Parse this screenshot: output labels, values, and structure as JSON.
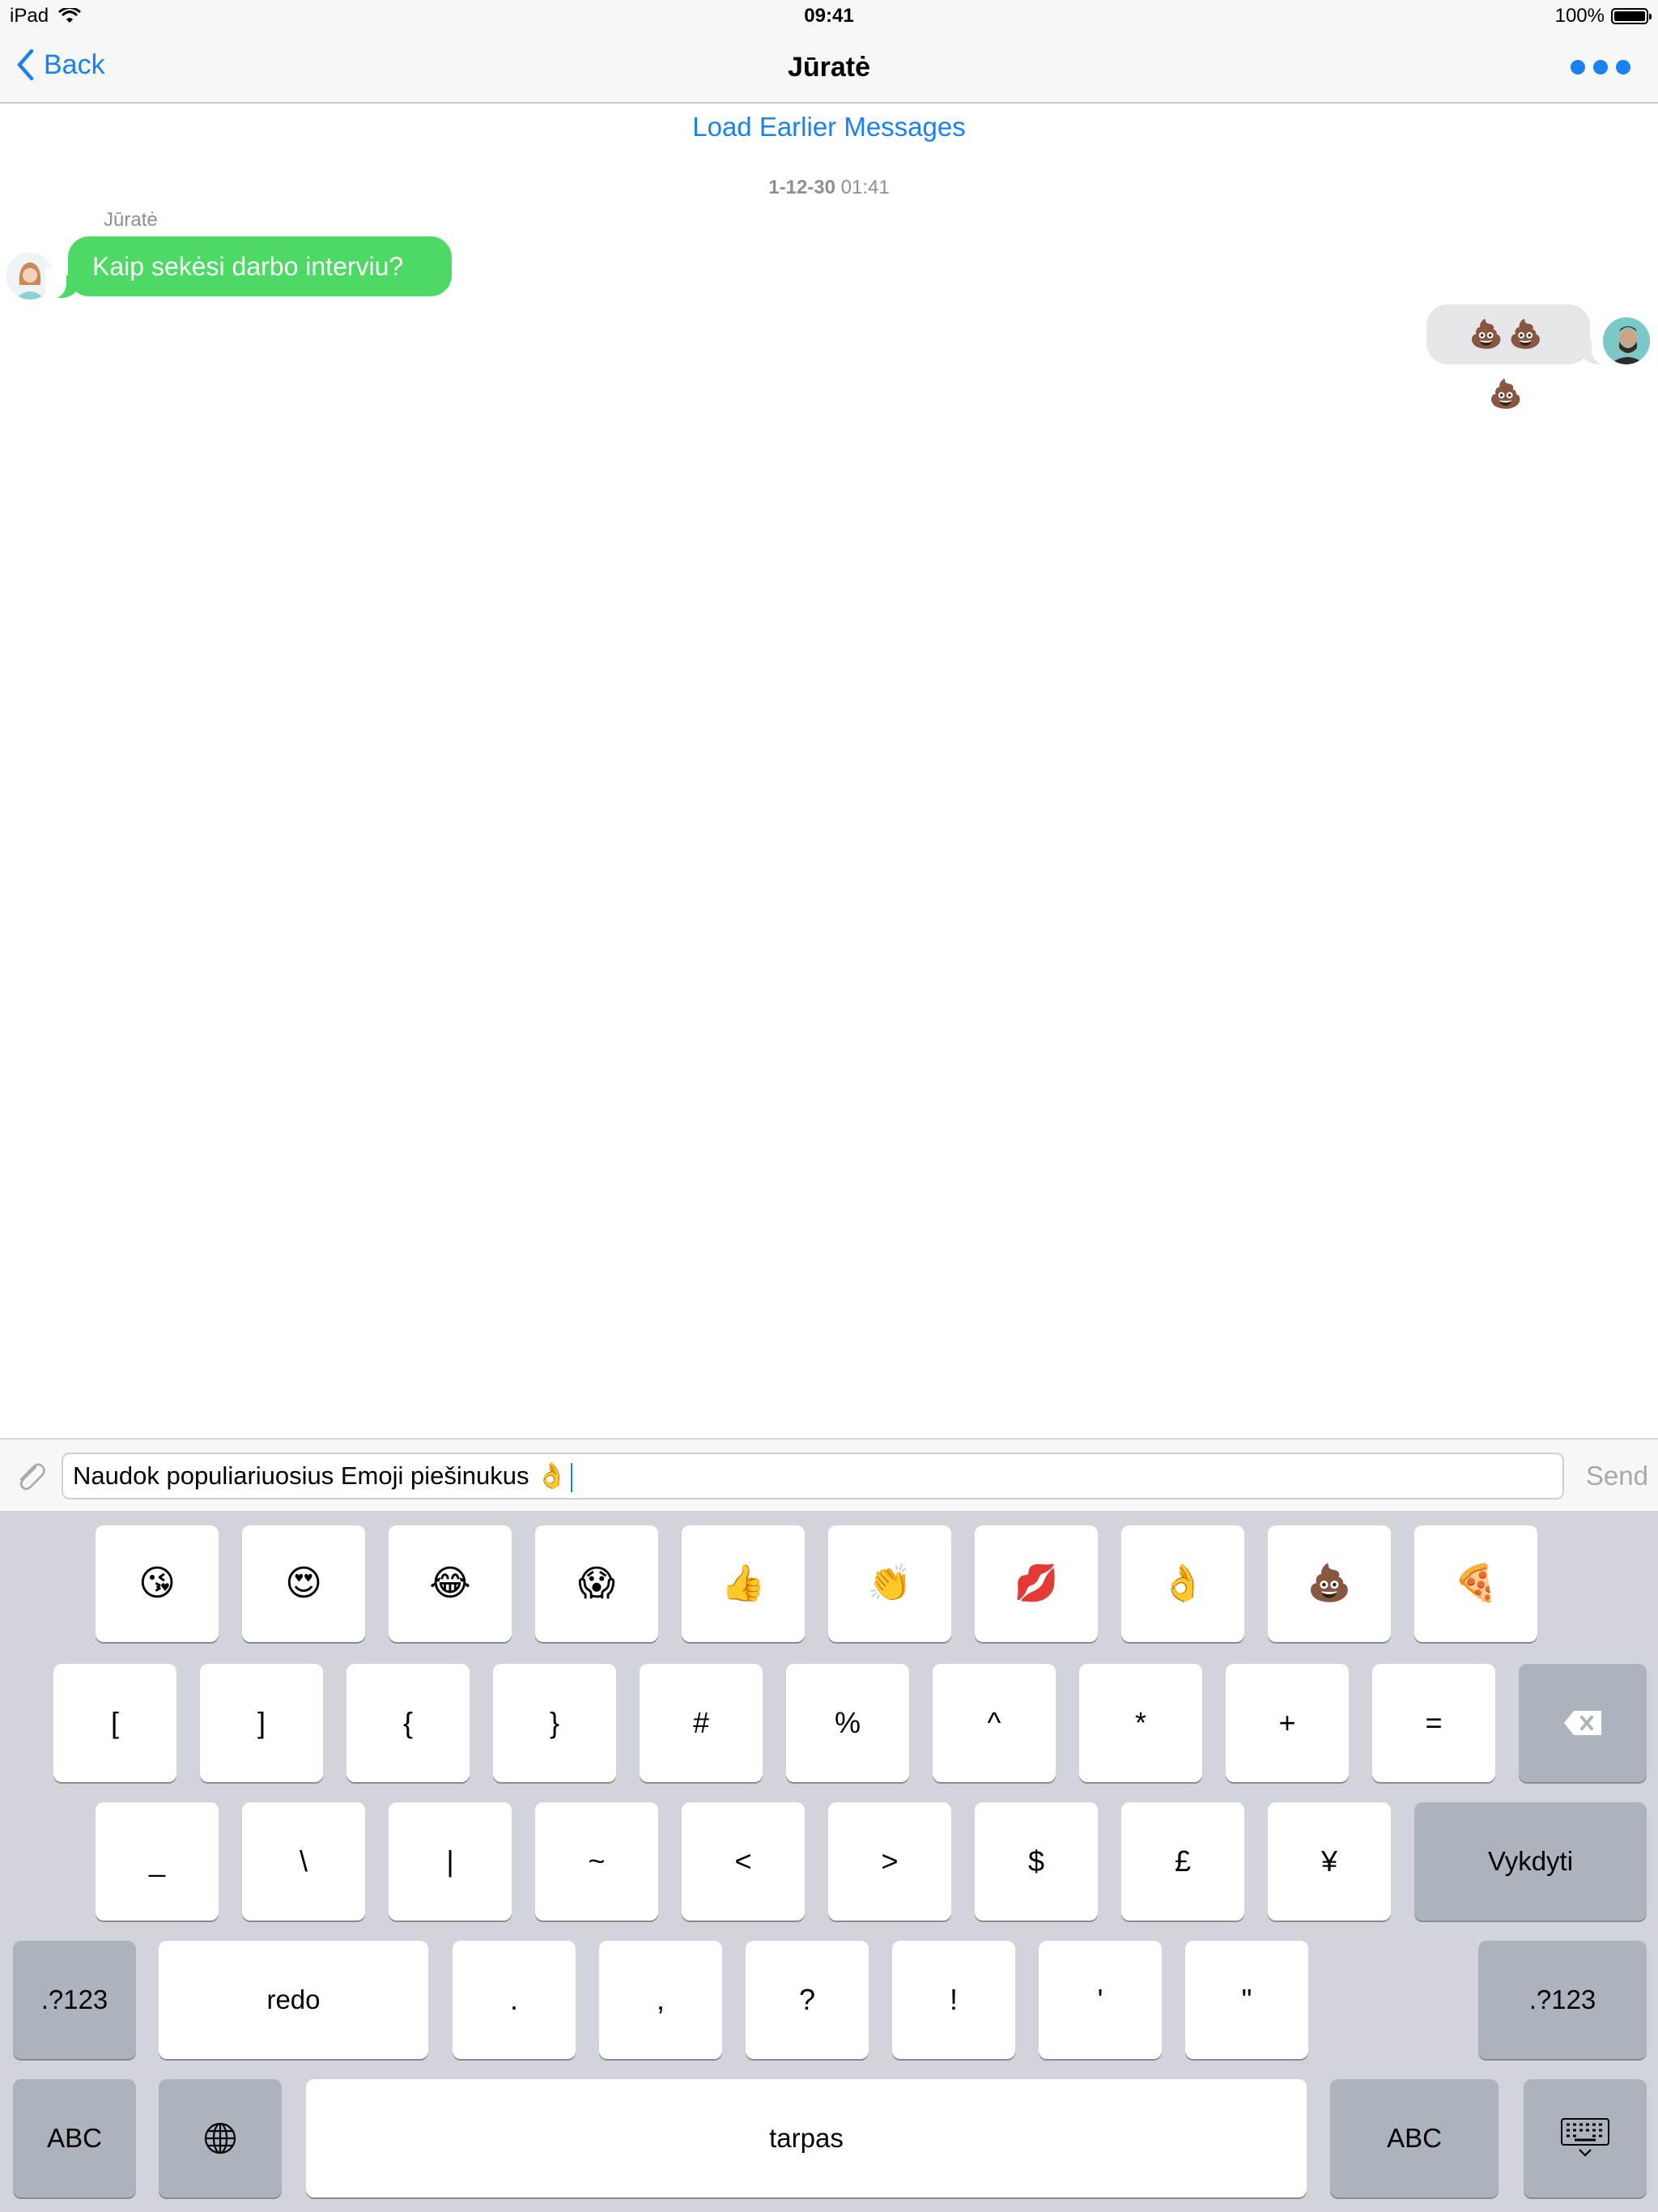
{
  "status_bar": {
    "device": "iPad",
    "time": "09:41",
    "battery": "100%",
    "battery_level": 1.0
  },
  "nav": {
    "back_label": "Back",
    "title": "Jūratė"
  },
  "conversation": {
    "load_earlier": "Load Earlier Messages",
    "date": "1-12-30",
    "time": "01:41",
    "messages": [
      {
        "sender": "Jūratė",
        "text": "Kaip sekėsi darbo interviu?",
        "direction": "incoming"
      },
      {
        "text": "💩💩💩",
        "direction": "outgoing"
      }
    ]
  },
  "composer": {
    "text": "Naudok populiariuosius Emoji piešinukus 👌",
    "send_label": "Send"
  },
  "keyboard": {
    "emoji_row": [
      "😘",
      "😍",
      "😂",
      "😱",
      "👍",
      "👏",
      "💋",
      "👌",
      "💩",
      "🍕"
    ],
    "symbol_row_1": [
      "[",
      "]",
      "{",
      "}",
      "#",
      "%",
      "^",
      "*",
      "+",
      "="
    ],
    "symbol_row_2": [
      "_",
      "\\",
      "|",
      "~",
      "<",
      ">",
      "$",
      "£",
      "¥"
    ],
    "return_label": "Vykdyti",
    "mode_label_123": ".?123",
    "redo_label": "redo",
    "punct_row": [
      ".",
      ",",
      "?",
      "!",
      "'",
      "\""
    ],
    "abc_label": "ABC",
    "space_label": "tarpas"
  },
  "colors": {
    "accent": "#1a82f0",
    "incoming_bubble": "#4cd964",
    "outgoing_bubble": "#e6e6ea",
    "keyboard_bg": "#d1d5db"
  }
}
